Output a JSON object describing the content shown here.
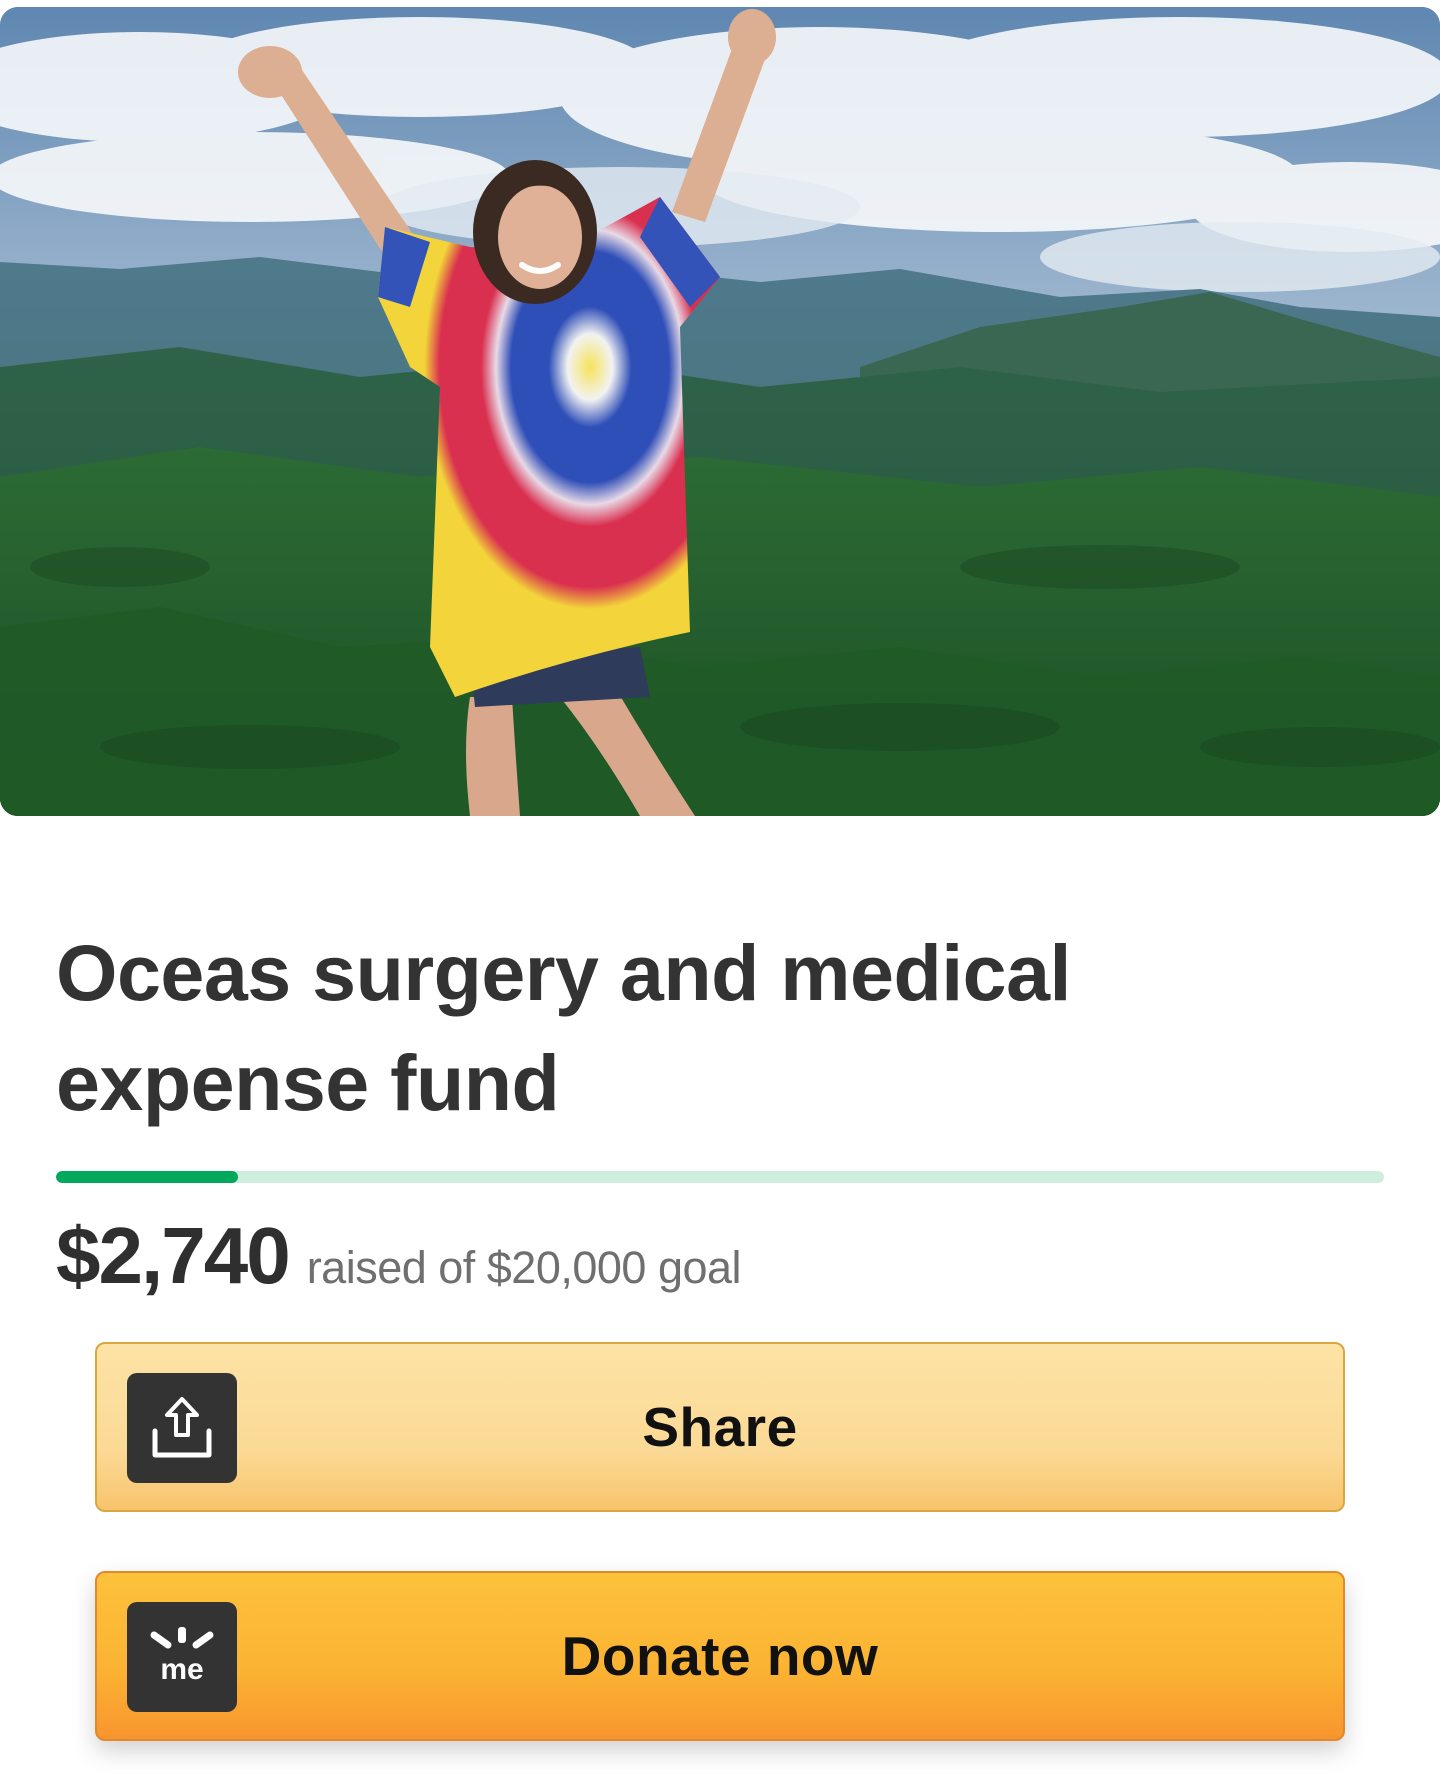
{
  "campaign": {
    "title": "Oceas surgery and medical expense fund",
    "raised": "$2,740",
    "raised_suffix": "raised of $20,000 goal",
    "progress_fraction": 0.137
  },
  "buttons": {
    "share_label": "Share",
    "donate_label": "Donate now",
    "share_icon": "share-upload-icon",
    "donate_icon": "gofundme-logo-icon"
  },
  "colors": {
    "progress_fill": "#02a95c",
    "progress_track": "#cdeedd",
    "donate_accent": "#fbb232",
    "share_accent": "#fbd995"
  }
}
